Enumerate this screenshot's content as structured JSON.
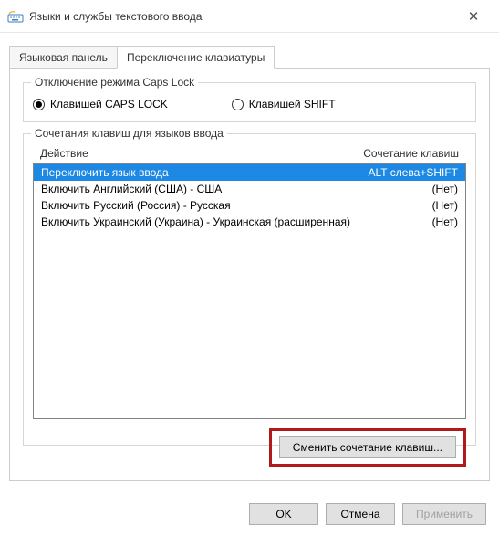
{
  "window": {
    "title": "Языки и службы текстового ввода",
    "close_glyph": "✕"
  },
  "tabs": {
    "lang_panel": "Языковая панель",
    "kb_switch": "Переключение клавиатуры"
  },
  "capslock": {
    "legend": "Отключение режима Caps Lock",
    "opt_caps": "Клавишей CAPS LOCK",
    "opt_shift": "Клавишей SHIFT"
  },
  "hotkeys": {
    "legend": "Сочетания клавиш для языков ввода",
    "col_action": "Действие",
    "col_combo": "Сочетание клавиш",
    "rows": [
      {
        "action": "Переключить язык ввода",
        "combo": "ALT слева+SHIFT",
        "selected": true
      },
      {
        "action": "Включить Английский (США) - США",
        "combo": "(Нет)",
        "selected": false
      },
      {
        "action": "Включить Русский (Россия) - Русская",
        "combo": "(Нет)",
        "selected": false
      },
      {
        "action": "Включить Украинский (Украина) - Украинская (расширенная)",
        "combo": "(Нет)",
        "selected": false
      }
    ],
    "change_btn": "Сменить сочетание клавиш..."
  },
  "footer": {
    "ok": "OK",
    "cancel": "Отмена",
    "apply": "Применить"
  }
}
